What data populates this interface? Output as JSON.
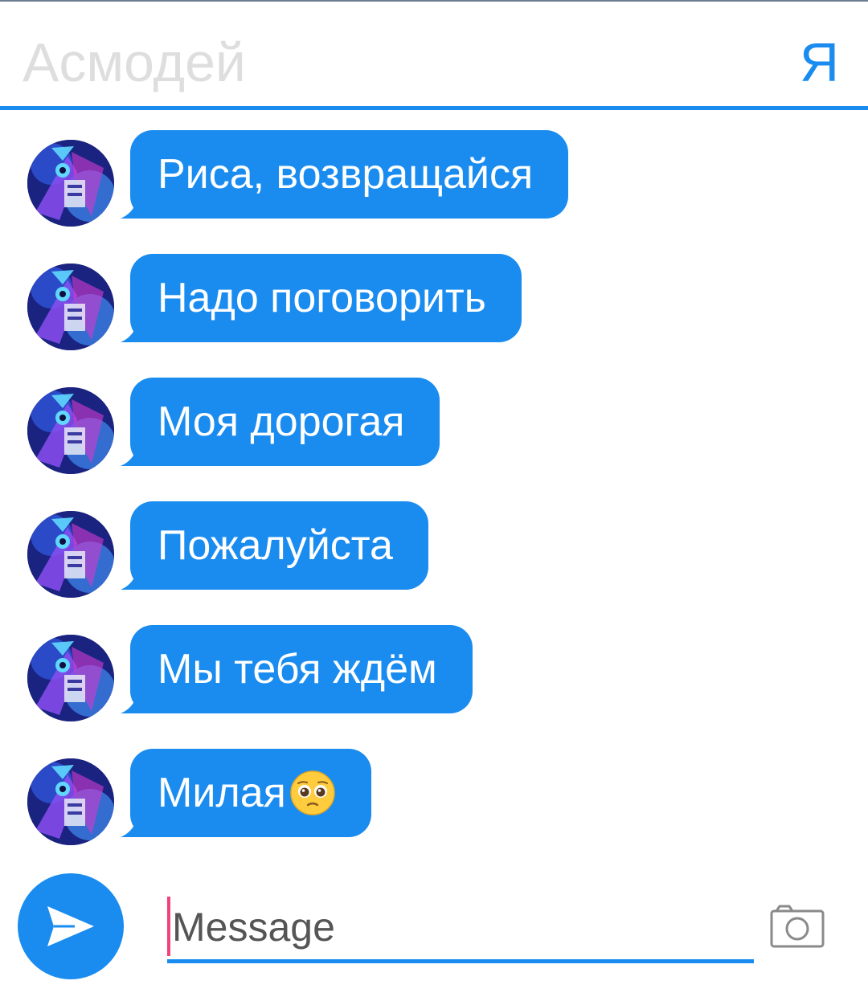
{
  "header": {
    "contact_name": "Асмодей",
    "me_label": "Я"
  },
  "colors": {
    "accent": "#1a8cf0",
    "bubble_text": "#ffffff",
    "name_placeholder": "#dedede",
    "caret": "#f0437a"
  },
  "messages": [
    {
      "text": "Риса, возвращайся"
    },
    {
      "text": "Надо поговорить"
    },
    {
      "text": "Моя дорогая"
    },
    {
      "text": "Пожалуйста"
    },
    {
      "text": "Мы тебя ждём"
    },
    {
      "text": "Милая",
      "emoji": "pleading-face-emoji"
    }
  ],
  "composer": {
    "placeholder": "Message",
    "send_icon": "send-icon",
    "camera_icon": "camera-icon"
  }
}
